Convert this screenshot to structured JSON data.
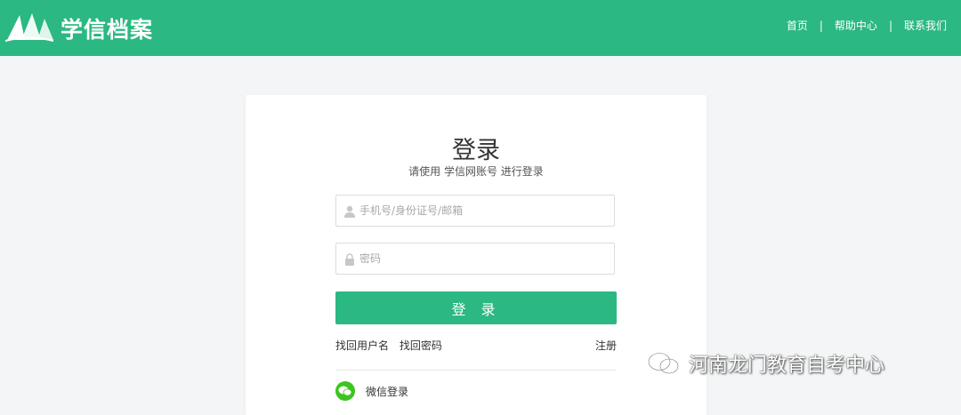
{
  "header": {
    "brand": "学信档案",
    "nav": [
      {
        "label": "首页"
      },
      {
        "label": "帮助中心"
      },
      {
        "label": "联系我们"
      }
    ],
    "separator": "|",
    "bg_color": "#2bb882"
  },
  "login": {
    "title": "登录",
    "subtitle": "请使用 学信网账号 进行登录",
    "username_placeholder": "手机号/身份证号/邮箱",
    "password_placeholder": "密码",
    "submit_label": "登 录",
    "find_username": "找回用户名",
    "find_password": "找回密码",
    "register": "注册",
    "wechat_login": "微信登录"
  },
  "watermark": {
    "text": "河南龙门教育自考中心"
  },
  "icons": [
    "logo-icon",
    "user-icon",
    "lock-icon",
    "wechat-icon"
  ]
}
